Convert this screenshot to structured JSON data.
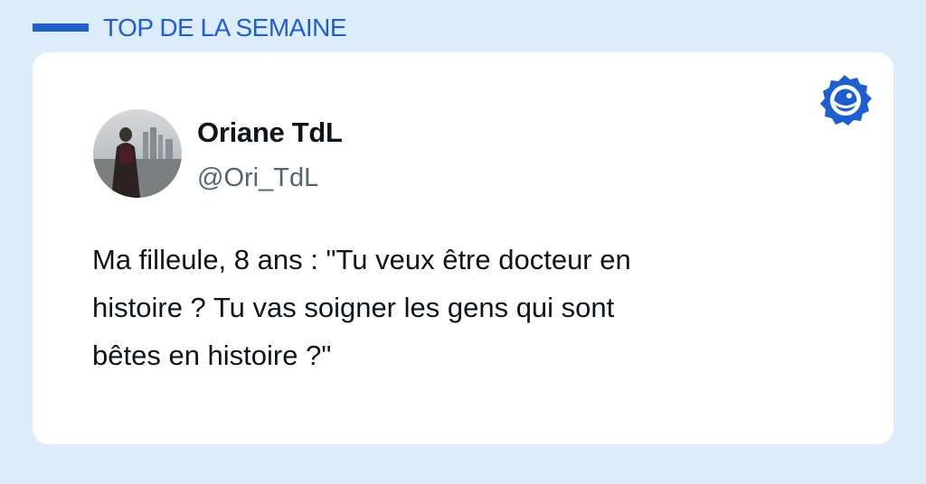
{
  "header": {
    "title": "TOP DE LA SEMAINE"
  },
  "tweet": {
    "author_name": "Oriane TdL",
    "author_handle": "@Ori_TdL",
    "text_lines": [
      "Ma filleule, 8 ans : \"Tu veux être docteur en",
      "histoire ? Tu vas soigner les gens qui sont",
      "bêtes en histoire ?\""
    ]
  },
  "colors": {
    "background": "#dcecfb",
    "accent": "#1d5fd0",
    "card": "#ffffff",
    "text": "#0f1419",
    "handle": "#536471"
  },
  "icons": {
    "brand": "eye-badge-icon",
    "avatar": "user-photo"
  }
}
